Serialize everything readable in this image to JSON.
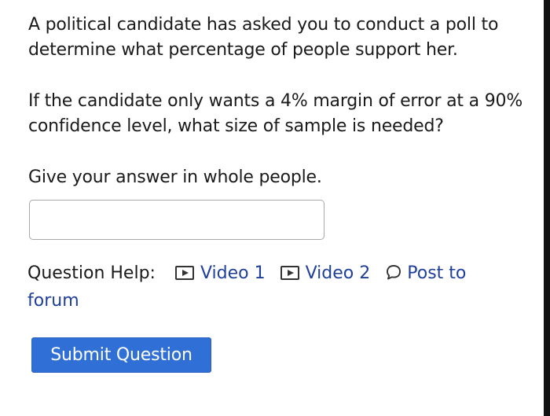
{
  "question": {
    "paragraph1": "A political candidate has asked you to conduct a poll to determine what percentage of people support her.",
    "paragraph2": "If the candidate only wants a 4% margin of error at a 90% confidence level, what size of sample is needed?",
    "paragraph3": "Give your answer in whole people."
  },
  "answer_input": {
    "value": "",
    "placeholder": ""
  },
  "help": {
    "label": "Question Help:",
    "links": [
      {
        "label": "Video 1",
        "icon": "video-icon"
      },
      {
        "label": "Video 2",
        "icon": "video-icon"
      },
      {
        "label": "Post to forum",
        "icon": "chat-bubble-icon"
      }
    ]
  },
  "submit_label": "Submit Question",
  "colors": {
    "link": "#1f3f9a",
    "submit_background": "#2f6fd6",
    "text": "#1a1a1a"
  }
}
